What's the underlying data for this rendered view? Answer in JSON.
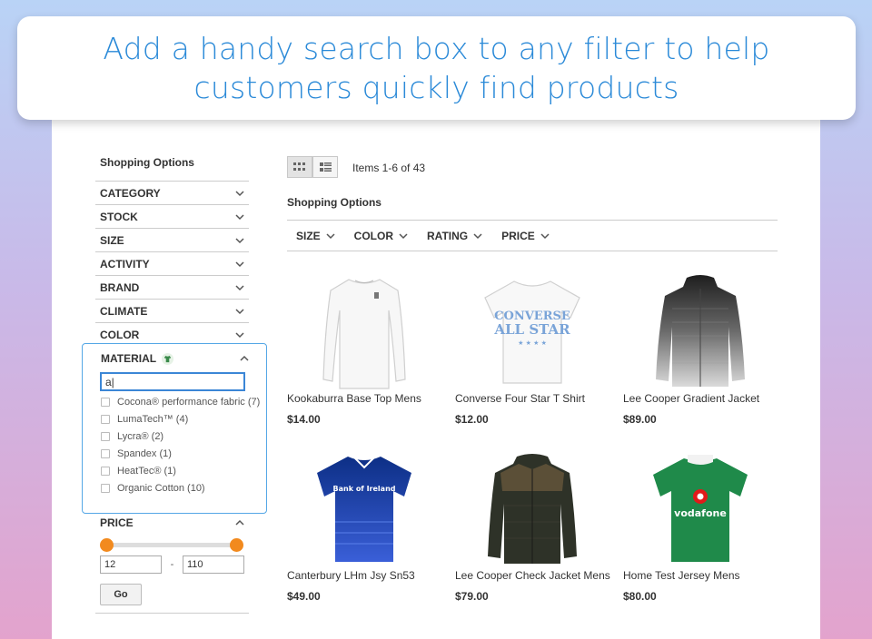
{
  "banner": {
    "line1": "Add a handy search box to any filter to help",
    "line2": "customers quickly find products"
  },
  "sidebar": {
    "title": "Shopping Options",
    "items": [
      {
        "label": "CATEGORY"
      },
      {
        "label": "STOCK"
      },
      {
        "label": "SIZE"
      },
      {
        "label": "ACTIVITY"
      },
      {
        "label": "BRAND"
      },
      {
        "label": "CLIMATE"
      },
      {
        "label": "COLOR"
      }
    ],
    "material": {
      "label": "MATERIAL",
      "search_value": "a|",
      "options": [
        {
          "label": "Cocona® performance fabric (7)"
        },
        {
          "label": "LumaTech™ (4)"
        },
        {
          "label": "Lycra® (2)"
        },
        {
          "label": "Spandex (1)"
        },
        {
          "label": "HeatTec® (1)"
        },
        {
          "label": "Organic Cotton (10)"
        }
      ]
    },
    "price": {
      "label": "PRICE",
      "min": "12",
      "separator": "-",
      "max": "110",
      "go_label": "Go"
    }
  },
  "main": {
    "items_count": "Items 1-6 of 43",
    "shopping_options_title": "Shopping Options",
    "filters": [
      {
        "label": "SIZE"
      },
      {
        "label": "COLOR"
      },
      {
        "label": "RATING"
      },
      {
        "label": "PRICE"
      }
    ],
    "products": [
      {
        "name": "Kookaburra Base Top Mens",
        "price": "$14.00"
      },
      {
        "name": "Converse Four Star T Shirt",
        "price": "$12.00"
      },
      {
        "name": "Lee Cooper Gradient Jacket",
        "price": "$89.00"
      },
      {
        "name": "Canterbury LHm Jsy Sn53",
        "price": "$49.00"
      },
      {
        "name": "Lee Cooper Check Jacket Mens",
        "price": "$79.00"
      },
      {
        "name": "Home Test Jersey Mens",
        "price": "$80.00"
      }
    ]
  },
  "colors": {
    "banner_text": "#2b8ad8",
    "search_border": "#3b86d6",
    "slider_handle": "#f28a1e",
    "match_highlight": "#e8d4f0"
  }
}
